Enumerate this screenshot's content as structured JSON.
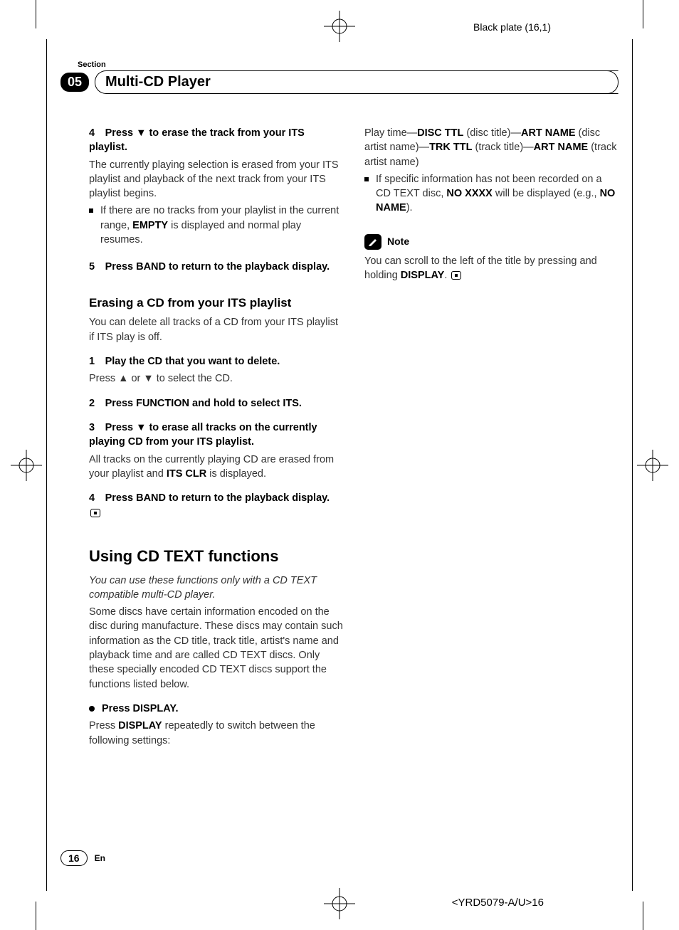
{
  "meta": {
    "black_plate": "Black plate (16,1)",
    "footer_code": "<YRD5079-A/U>16"
  },
  "header": {
    "section_label": "Section",
    "section_number": "05",
    "title": "Multi-CD Player"
  },
  "left": {
    "step4_title": "4 Press ▼ to erase the track from your ITS playlist.",
    "step4_body": "The currently playing selection is erased from your ITS playlist and playback of the next track from your ITS playlist begins.",
    "step4_bullet_a": "If there are no tracks from your playlist in the current range, ",
    "step4_bullet_b": "EMPTY",
    "step4_bullet_c": " is displayed and normal play resumes.",
    "step5_title": "5 Press BAND to return to the playback display.",
    "sub_heading": "Erasing a CD from your ITS playlist",
    "sub_intro": "You can delete all tracks of a CD from your ITS playlist if ITS play is off.",
    "e_step1_title": "1 Play the CD that you want to delete.",
    "e_step1_body": "Press ▲ or ▼ to select the CD.",
    "e_step2_title": "2 Press FUNCTION and hold to select ITS.",
    "e_step3_title": "3 Press ▼ to erase all tracks on the currently playing CD from your ITS playlist.",
    "e_step3_body_a": "All tracks on the currently playing CD are erased from your playlist and ",
    "e_step3_body_b": "ITS CLR",
    "e_step3_body_c": " is displayed.",
    "e_step4_title": "4 Press BAND to return to the playback display.",
    "major_heading": "Using CD TEXT functions",
    "major_italic": "You can use these functions only with a CD TEXT compatible multi-CD player.",
    "major_body": "Some discs have certain information encoded on the disc during manufacture. These discs may contain such information as the CD title, track title, artist's name and playback time and are called CD TEXT discs. Only these specially encoded CD TEXT discs support the functions listed below.",
    "press_display_title": "Press DISPLAY.",
    "press_display_body_a": "Press ",
    "press_display_body_b": "DISPLAY",
    "press_display_body_c": " repeatedly to switch between the following settings:"
  },
  "right": {
    "settings_a": "Play time—",
    "settings_b": "DISC TTL",
    "settings_c": " (disc title)—",
    "settings_d": "ART NAME",
    "settings_e": " (disc artist name)—",
    "settings_f": "TRK TTL",
    "settings_g": " (track title)—",
    "settings_h": "ART NAME",
    "settings_i": " (track artist name)",
    "bullet_a": "If specific information has not been recorded on a CD TEXT disc, ",
    "bullet_b": "NO XXXX",
    "bullet_c": " will be displayed (e.g., ",
    "bullet_d": "NO NAME",
    "bullet_e": ").",
    "note_label": "Note",
    "note_body_a": "You can scroll to the left of the title by pressing and holding ",
    "note_body_b": "DISPLAY",
    "note_body_c": "."
  },
  "footer": {
    "page_number": "16",
    "lang": "En"
  }
}
